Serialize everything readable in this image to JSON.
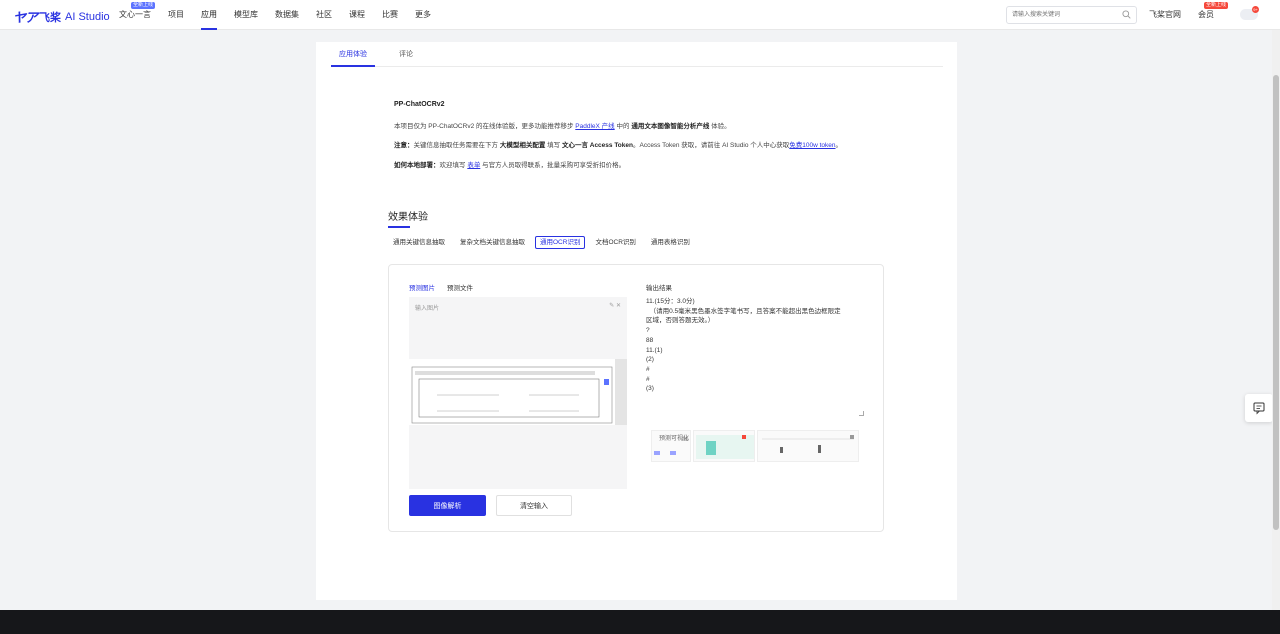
{
  "brand": {
    "cn": "飞桨",
    "en": "AI Studio"
  },
  "nav": {
    "items": [
      {
        "label": "文心一言",
        "badge": "全新上线"
      },
      {
        "label": "项目"
      },
      {
        "label": "应用",
        "active": true
      },
      {
        "label": "模型库"
      },
      {
        "label": "数据集"
      },
      {
        "label": "社区"
      },
      {
        "label": "课程"
      },
      {
        "label": "比赛"
      },
      {
        "label": "更多"
      }
    ],
    "search_placeholder": "请输入搜索关键词",
    "official_site": "飞桨官网",
    "member": "会员",
    "member_badge": "全新上线",
    "notify_count": "9+"
  },
  "page_tabs": [
    "应用体验",
    "评论"
  ],
  "app": {
    "title": "PP-ChatOCRv2",
    "intro_1": "本项目仅为 PP-ChatOCRv2 的在线体验版，更多功能推荐移步 ",
    "intro_link": "PaddleX 产线",
    "intro_2": " 中的 ",
    "intro_bold": "通用文本图像智能分析产线",
    "intro_3": " 体验。",
    "note_label": "注意：",
    "note_1": "关键信息抽取任务需要在下方 ",
    "note_bold_1": "大模型相关配置",
    "note_2": " 填写 ",
    "note_bold_2": "文心一言 Access Token",
    "note_3": "。Access Token 获取，请前往 AI Studio 个人中心获取",
    "note_link": "免费100w token",
    "note_4": "。",
    "deploy_label": "如何本地部署：",
    "deploy_1": "欢迎填写 ",
    "deploy_link": "表单",
    "deploy_2": " 与官方人员取得联系，批量采购可享受折扣价格。"
  },
  "section": {
    "title": "效果体验",
    "modes": [
      "通用关键信息抽取",
      "复杂文档关键信息抽取",
      "通用OCR识别",
      "文档OCR识别",
      "通用表格识别"
    ],
    "active_mode": 2
  },
  "panel": {
    "sub_tabs": [
      "预测图片",
      "预测文件"
    ],
    "input_label": "输入图片",
    "input_tools": "✎  ✕",
    "output_label": "输出结果",
    "output_lines": [
      "11.(15分：3.0分)",
      "  （请用0.5毫米黑色墨水签字笔书写，且答案不能超出黑色边框限定",
      "区域，否则答题无效。）",
      "?",
      "88",
      "11.(1)",
      "(2)",
      "#",
      "#",
      "(3)"
    ],
    "viz_label": "预测可视化",
    "analyze_button": "图像解析",
    "clear_button": "清空输入"
  },
  "colors": {
    "accent": "#2932e1",
    "badge_red": "#f5483b",
    "footer": "#16171a"
  }
}
